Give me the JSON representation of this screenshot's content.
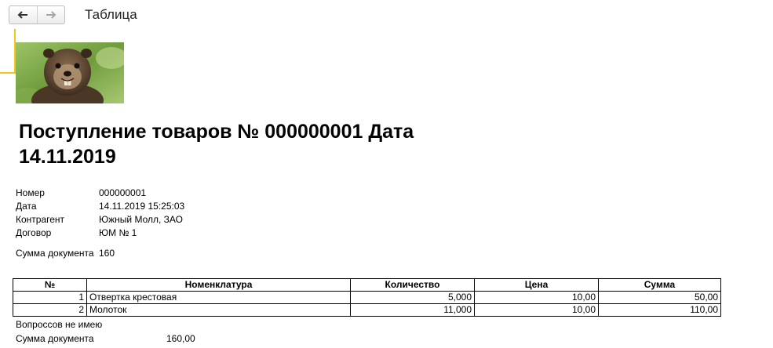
{
  "window": {
    "title": "Таблица"
  },
  "toolbar": {
    "back_icon": "arrow-left",
    "forward_icon": "arrow-right"
  },
  "picture": {
    "subject": "marmot"
  },
  "document": {
    "title": "Поступление товаров № 000000001 Дата 14.11.2019",
    "attributes": [
      {
        "label": "Номер",
        "value": "000000001"
      },
      {
        "label": "Дата",
        "value": "14.11.2019 15:25:03"
      },
      {
        "label": "Контрагент",
        "value": "Южный Молл, ЗАО"
      },
      {
        "label": "Договор",
        "value": "ЮМ № 1"
      },
      {
        "label": "Сумма документа",
        "value": "160"
      }
    ],
    "table": {
      "headers": [
        "№",
        "Номенклатура",
        "Количество",
        "Цена",
        "Сумма"
      ],
      "rows": [
        [
          "1",
          "Отвертка крестовая",
          "5,000",
          "10,00",
          "50,00"
        ],
        [
          "2",
          "Молоток",
          "11,000",
          "10,00",
          "110,00"
        ]
      ]
    },
    "footer_note": "Вопроссов не имею",
    "footer_sum_label": "Сумма документа",
    "footer_sum_value": "160,00"
  },
  "colors": {
    "cell_marker": "#f5c518"
  }
}
